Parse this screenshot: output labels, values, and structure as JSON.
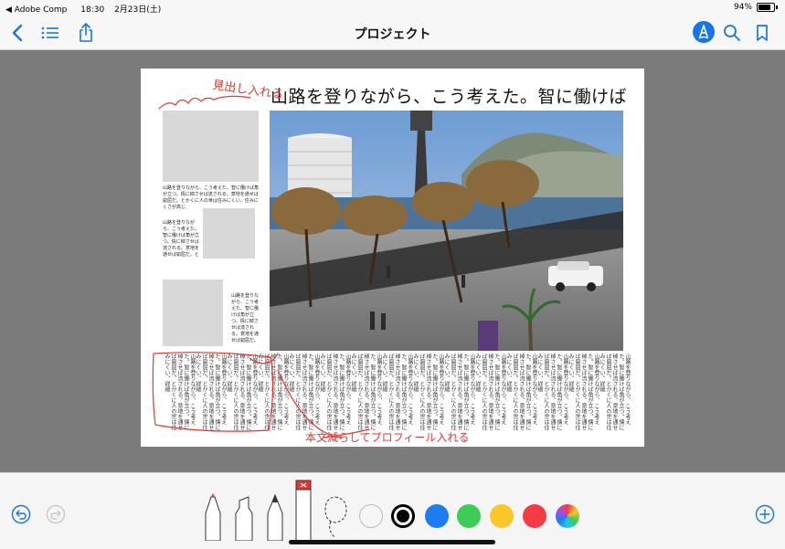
{
  "status_bar": {
    "back_app": "◀ Adobe Comp",
    "time": "18:30",
    "date": "2月23日(土)",
    "battery": "94%",
    "battery_level": 0.94
  },
  "nav": {
    "title": "プロジェクト"
  },
  "page": {
    "headline": "山路を登りながら、こう考えた。智に働けば",
    "caption_1": "山路を登りながら、こう考えた。智に働けば角が立つ。情に棹させば流される。意地を通せば窮屈だ。とかくに人の世は住みにくい。住みにくさが高じ",
    "caption_2": "山路を登りながら、こう考えた。智に働けば角が立つ。情に棹させば流される。意地を通せば窮屈だ。と",
    "caption_3": "山路を登りながら、こう考えた。智に働けば角が立つ。情に棹させば流される。意地を通せば窮屈だ。",
    "vertical_column": "山路を登りながら、こう考えた。智に働けば角が立つ。情に棹させば流される。意地を通せば窮屈だ。とかくに人の世は住みにくい。詳細",
    "annotation_heading": "見出し入れる",
    "annotation_bottom": "本文減らしてプロフィール入れる"
  },
  "colors": {
    "accent": "#1a73e8",
    "annotation_red": "#e8342e",
    "swatch_white": "#ffffff",
    "swatch_black": "#000000",
    "swatch_blue": "#1e7cf2",
    "swatch_green": "#3dcc55",
    "swatch_yellow": "#fbc628",
    "swatch_red": "#f33b46"
  },
  "icons": {
    "back": "chevron-left-icon",
    "list": "list-icon",
    "share": "share-icon",
    "markup": "markup-pen-icon",
    "search": "search-icon",
    "bookmark": "bookmark-icon",
    "undo": "undo-icon",
    "redo": "redo-icon",
    "add": "plus-circle-icon"
  }
}
